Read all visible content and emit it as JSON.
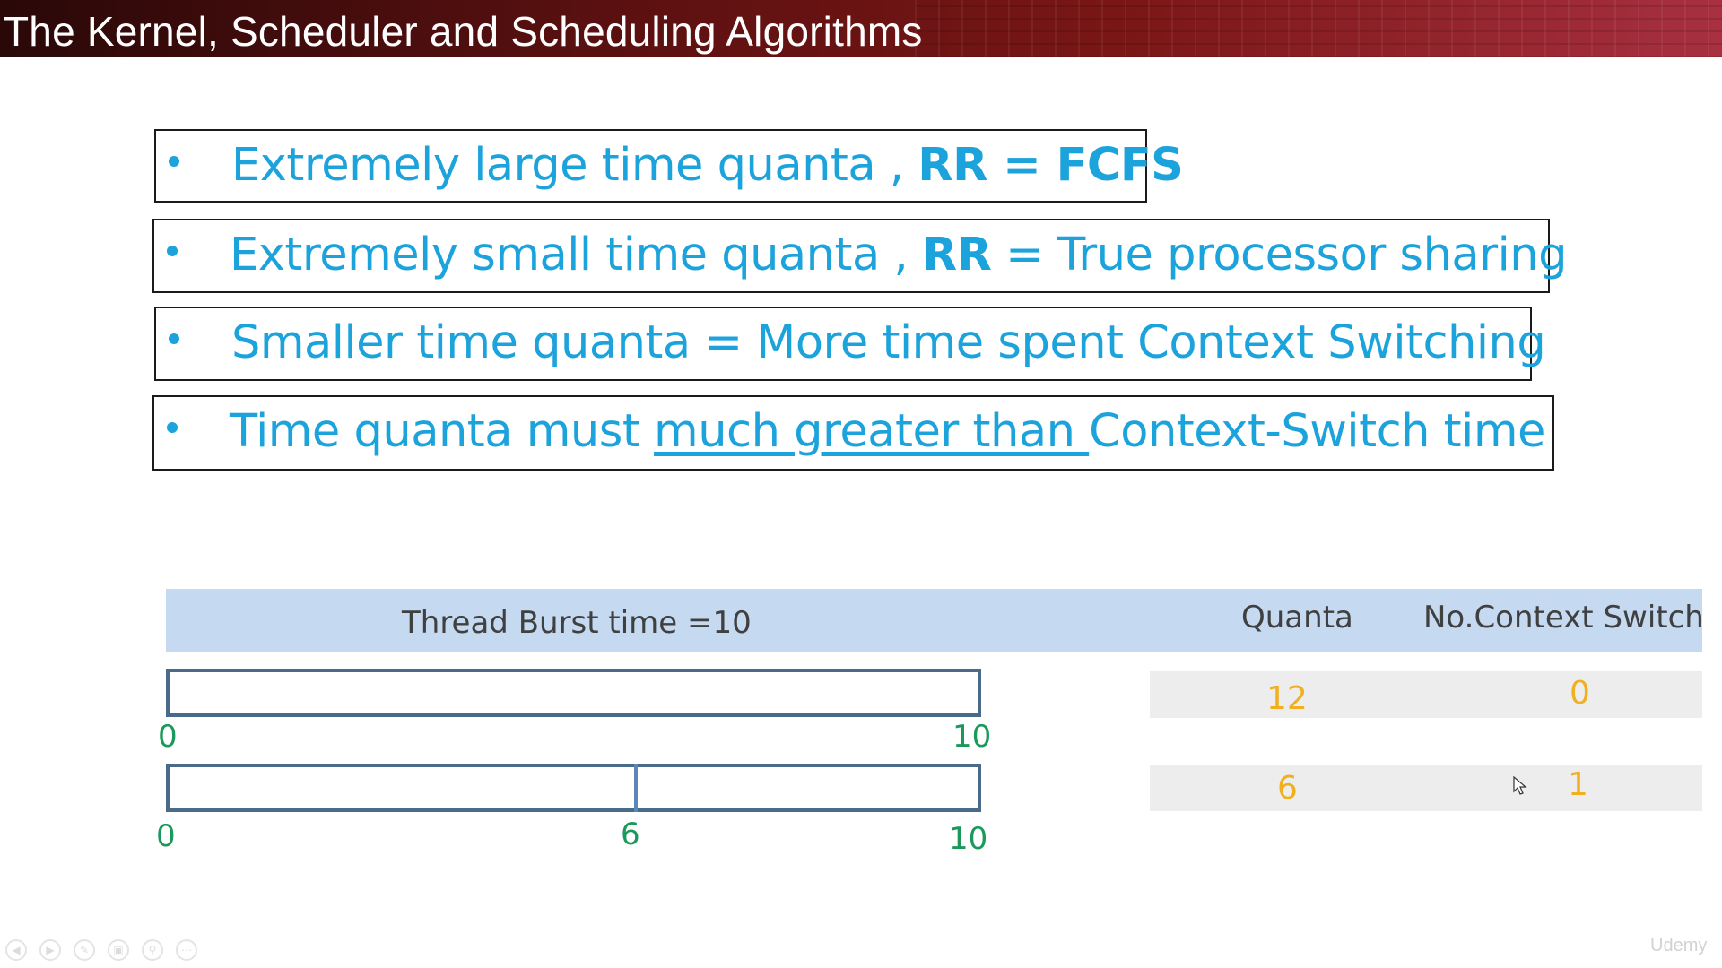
{
  "slide": {
    "title": "The Kernel, Scheduler and Scheduling Algorithms",
    "bullets": [
      {
        "pre": "Extremely large time quanta , ",
        "bold": "RR = FCFS",
        "post": ""
      },
      {
        "pre": "Extremely small time quanta , ",
        "bold": "RR",
        "post": " = True processor sharing"
      },
      {
        "pre": "Smaller time quanta = More time spent Context Switching"
      },
      {
        "pre": "Time quanta  must ",
        "underline": "much greater than ",
        "post": "Context-Switch time"
      }
    ],
    "table": {
      "burst_label": "Thread Burst time =",
      "burst_value": "10",
      "quanta_header": "Quanta",
      "switch_header": "No.Context Switch"
    },
    "bars": [
      {
        "ticks": [
          "0",
          "10"
        ]
      },
      {
        "ticks": [
          "0",
          "6",
          "10"
        ],
        "divider_at": 6
      }
    ],
    "rows": [
      {
        "quanta": "12",
        "switches": "0"
      },
      {
        "quanta": "6",
        "switches": "1"
      }
    ],
    "colors": {
      "bullet_text": "#1ca3dc",
      "header_band": "#c5d9f0",
      "tick_labels": "#1a9a5a",
      "result_values": "#f0b020",
      "bar_border": "#4a6a8a"
    }
  },
  "player": {
    "controls": [
      "previous-icon",
      "play-icon",
      "pen-icon",
      "slides-icon",
      "zoom-icon",
      "more-icon"
    ]
  },
  "watermark": {
    "text": "Udemy"
  }
}
